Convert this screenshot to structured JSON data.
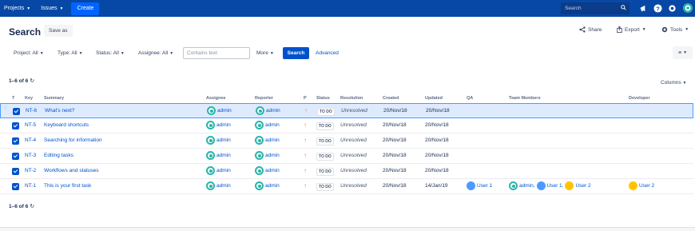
{
  "nav": {
    "projects": "Projects",
    "issues": "Issues",
    "create": "Create",
    "search_placeholder": "Search"
  },
  "header": {
    "title": "Search",
    "save_as": "Save as",
    "share": "Share",
    "export": "Export",
    "tools": "Tools"
  },
  "filters": {
    "project": "Project: All",
    "type": "Type: All",
    "status": "Status: All",
    "assignee": "Assignee: All",
    "contains_placeholder": "Contains text",
    "more": "More",
    "search": "Search",
    "advanced": "Advanced"
  },
  "results": {
    "count_top": "1–6 of 6",
    "count_bottom": "1–6 of 6",
    "columns": "Columns"
  },
  "table": {
    "headers": [
      "T",
      "Key",
      "Summary",
      "Assignee",
      "Reporter",
      "P",
      "Status",
      "Resolution",
      "Created",
      "Updated",
      "QA",
      "Team Members",
      "Developer"
    ],
    "rows": [
      {
        "key": "NT-6",
        "summary": "What's next?",
        "assignee": "admin",
        "reporter": "admin",
        "status": "TO DO",
        "resolution": "Unresolved",
        "created": "20/Nov/18",
        "updated": "20/Nov/18",
        "qa": "",
        "team": [],
        "developer": ""
      },
      {
        "key": "NT-5",
        "summary": "Keyboard shortcuts",
        "assignee": "admin",
        "reporter": "admin",
        "status": "TO DO",
        "resolution": "Unresolved",
        "created": "20/Nov/18",
        "updated": "20/Nov/18",
        "qa": "",
        "team": [],
        "developer": ""
      },
      {
        "key": "NT-4",
        "summary": "Searching for information",
        "assignee": "admin",
        "reporter": "admin",
        "status": "TO DO",
        "resolution": "Unresolved",
        "created": "20/Nov/18",
        "updated": "20/Nov/18",
        "qa": "",
        "team": [],
        "developer": ""
      },
      {
        "key": "NT-3",
        "summary": "Editing tasks",
        "assignee": "admin",
        "reporter": "admin",
        "status": "TO DO",
        "resolution": "Unresolved",
        "created": "20/Nov/18",
        "updated": "20/Nov/18",
        "qa": "",
        "team": [],
        "developer": ""
      },
      {
        "key": "NT-2",
        "summary": "Workflows and statuses",
        "assignee": "admin",
        "reporter": "admin",
        "status": "TO DO",
        "resolution": "Unresolved",
        "created": "20/Nov/18",
        "updated": "20/Nov/18",
        "qa": "",
        "team": [],
        "developer": ""
      },
      {
        "key": "NT-1",
        "summary": "This is your first task",
        "assignee": "admin",
        "reporter": "admin",
        "status": "TO DO",
        "resolution": "Unresolved",
        "created": "20/Nov/18",
        "updated": "14/Jan/19",
        "qa": "User 1",
        "team": [
          "admin,",
          "User 1,",
          "User 2"
        ],
        "developer": "User 2"
      }
    ]
  },
  "colors": {
    "nav_bg": "#0747a6",
    "primary": "#0052cc",
    "selected_row": "#deebff",
    "priority": "#ff7452",
    "admin_avatar": "#2ab5aa"
  },
  "icons": {
    "task_type": "checkbox-icon",
    "priority": "arrow-up-icon",
    "refresh": "refresh-icon"
  }
}
